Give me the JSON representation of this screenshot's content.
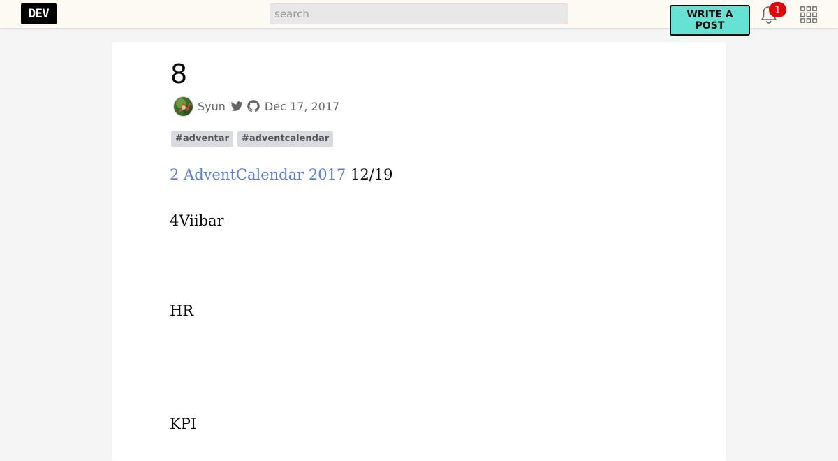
{
  "nav": {
    "logo_text": "DEV",
    "search_placeholder": "search",
    "write_button_label": "WRITE A POST",
    "notification_count": "1",
    "icons": [
      "bell-icon",
      "apps-grid-icon"
    ]
  },
  "article": {
    "title": "8",
    "author": "Syun",
    "date": "Dec 17, 2017",
    "social_icons": [
      "twitter-icon",
      "github-icon"
    ],
    "tags": [
      "#adventar",
      "#adventcalendar"
    ],
    "paragraphs": [
      {
        "link_text": "2 AdventCalendar 2017",
        "text": " 12/19"
      },
      {
        "text": "4Viibar"
      },
      {
        "text": "HR"
      },
      {
        "text": "KPI"
      }
    ]
  },
  "colors": {
    "accent": "#66e2d5",
    "link": "#557de8",
    "badge": "#e10707",
    "nav_bg": "#fdf9f3",
    "page_bg": "#f5f5f5"
  }
}
